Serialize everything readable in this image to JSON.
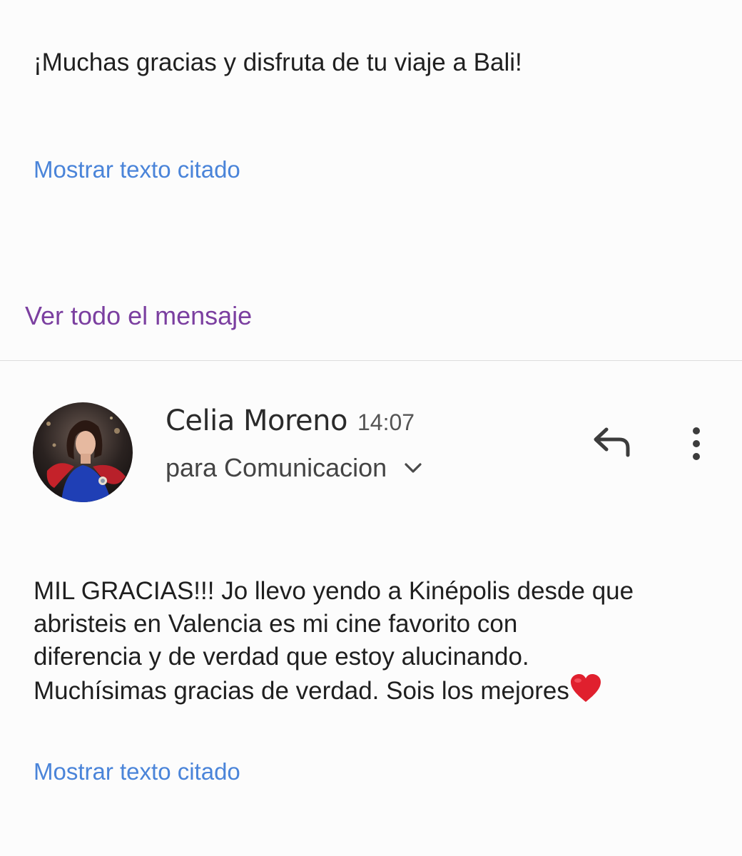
{
  "previous_message": {
    "text": "¡Muchas gracias y disfruta de tu viaje a Bali!",
    "show_quoted_label": "Mostrar texto citado",
    "view_full_label": "Ver todo el mensaje"
  },
  "message": {
    "sender_name": "Celia Moreno",
    "time": "14:07",
    "recipient_label": "para Comunicacion",
    "body_text": "MIL GRACIAS!!! Jo llevo yendo a Kinépolis desde que\nabristeis en Valencia es mi cine favorito con\ndiferencia y de verdad que estoy alucinando.\nMuchísimas gracias de verdad. Sois los mejores",
    "body_emoji": "heart-emoji",
    "show_quoted_label": "Mostrar texto citado"
  },
  "icons": {
    "avatar": "avatar-photo",
    "reply": "reply-icon",
    "more": "more-vertical-icon",
    "expand": "chevron-down-icon"
  },
  "colors": {
    "background": "#fcfcfc",
    "link_blue": "#4a84d9",
    "link_purple": "#7b3fa0",
    "heart": "#e0202e"
  }
}
